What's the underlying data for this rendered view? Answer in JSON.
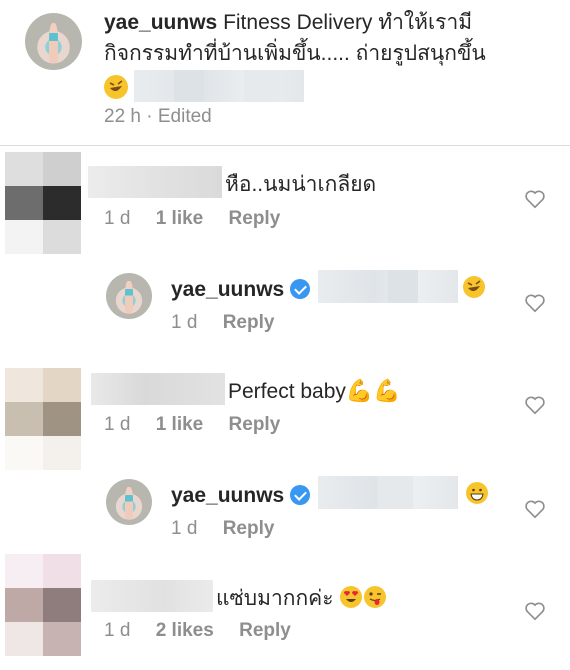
{
  "post": {
    "username": "yae_uunws",
    "caption_line1": "Fitness Delivery ทำให้เรามี",
    "caption_line2": "กิจกรรมทำที่บ้านเพิ่มขึ้น..... ถ่ายรูปสนุกขึ้น",
    "time": "22 h",
    "edited": "· Edited"
  },
  "comments": [
    {
      "text": "หือ..นมน่าเกลียด",
      "time": "1 d",
      "likes": "1 like",
      "reply": "Reply"
    },
    {
      "username": "yae_uunws",
      "time": "1 d",
      "reply": "Reply",
      "emoji": "rofl"
    },
    {
      "text": "Perfect baby",
      "emoji": "flexed-biceps",
      "time": "1 d",
      "likes": "1 like",
      "reply": "Reply"
    },
    {
      "username": "yae_uunws",
      "time": "1 d",
      "reply": "Reply",
      "emoji": "grinning"
    },
    {
      "text": "แซ่บมากกค่ะ",
      "emoji": "heart-eyes winking-tongue",
      "time": "1 d",
      "likes": "2 likes",
      "reply": "Reply"
    }
  ],
  "colors": {
    "text": "#262626",
    "meta": "#8e8e8e",
    "verified": "#3897f0"
  }
}
